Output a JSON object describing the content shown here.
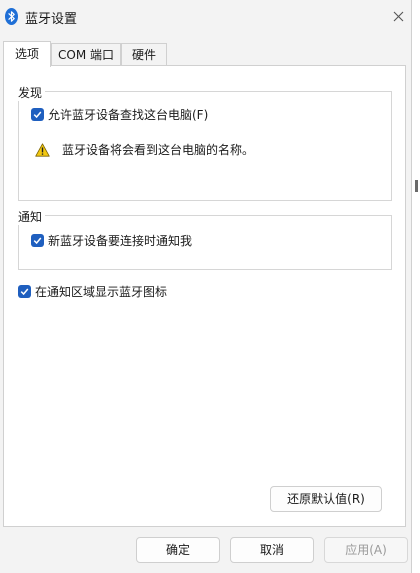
{
  "window": {
    "title": "蓝牙设置",
    "accent": "#1f5fbf"
  },
  "tabs": [
    {
      "label": "选项",
      "active": true
    },
    {
      "label": "COM 端口",
      "active": false
    },
    {
      "label": "硬件",
      "active": false
    }
  ],
  "discovery": {
    "label": "发现",
    "allow_label": "允许蓝牙设备查找这台电脑(F)",
    "allow_checked": true,
    "warning_icon": "warning-icon",
    "warning_text": "蓝牙设备将会看到这台电脑的名称。"
  },
  "notify": {
    "label": "通知",
    "new_device_label": "新蓝牙设备要连接时通知我",
    "new_device_checked": true
  },
  "tray": {
    "label": "在通知区域显示蓝牙图标",
    "checked": true
  },
  "buttons": {
    "restore_defaults": "还原默认值(R)",
    "ok": "确定",
    "cancel": "取消",
    "apply": "应用(A)"
  }
}
